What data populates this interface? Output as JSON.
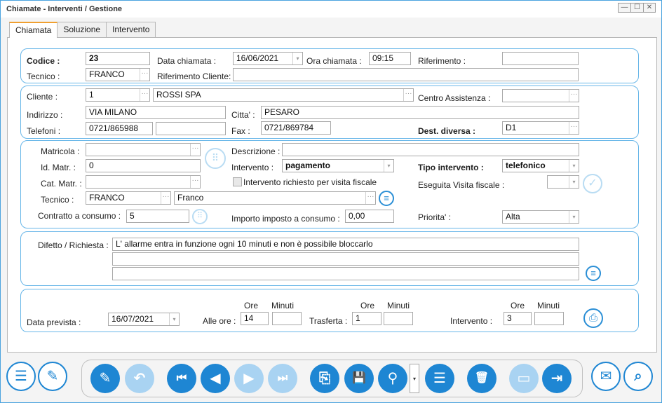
{
  "window": {
    "title": "Chiamate - Interventi / Gestione",
    "btn_min": "—",
    "btn_max": "☐",
    "btn_close": "✕"
  },
  "tabs": [
    {
      "label": "Chiamata"
    },
    {
      "label": "Soluzione"
    },
    {
      "label": "Intervento"
    }
  ],
  "header": {
    "codice_label": "Codice :",
    "codice_value": "23",
    "data_chiamata_label": "Data chiamata :",
    "data_chiamata_value": "16/06/2021",
    "ora_chiamata_label": "Ora chiamata :",
    "ora_chiamata_value": "09:15",
    "riferimento_label": "Riferimento :",
    "riferimento_value": "",
    "tecnico_label": "Tecnico :",
    "tecnico_value": "FRANCO",
    "rif_cliente_label": "Riferimento Cliente:",
    "rif_cliente_value": ""
  },
  "client": {
    "cliente_label": "Cliente :",
    "cliente_code": "1",
    "cliente_name": "ROSSI SPA",
    "centro_label": "Centro Assistenza :",
    "centro_value": "",
    "indirizzo_label": "Indirizzo :",
    "indirizzo_value": "VIA MILANO",
    "citta_label": "Citta' :",
    "citta_value": "PESARO",
    "telefoni_label": "Telefoni :",
    "telefoni_value1": "0721/865988",
    "telefoni_value2": "",
    "fax_label": "Fax :",
    "fax_value": "0721/869784",
    "dest_label": "Dest. diversa :",
    "dest_value": "D1"
  },
  "machine": {
    "matricola_label": "Matricola :",
    "matricola_value": "",
    "descrizione_label": "Descrizione :",
    "descrizione_value": "",
    "idmatr_label": "Id. Matr. :",
    "idmatr_value": "0",
    "intervento_label": "Intervento :",
    "intervento_value": "pagamento",
    "tipo_label": "Tipo intervento :",
    "tipo_value": "telefonico",
    "catmatr_label": "Cat. Matr. :",
    "catmatr_value": "",
    "visita_fiscale_label": "Intervento richiesto per visita fiscale",
    "eseguita_label": "Eseguita Visita fiscale :",
    "eseguita_value": "",
    "tecnico_label": "Tecnico :",
    "tecnico_code": "FRANCO",
    "tecnico_name": "Franco",
    "contratto_label": "Contratto a consumo :",
    "contratto_value": "5",
    "importo_label": "Importo imposto a consumo :",
    "importo_value": "0,00",
    "priorita_label": "Priorita' :",
    "priorita_value": "Alta"
  },
  "difetto": {
    "label": "Difetto / Richiesta :",
    "line1": "L' allarme entra in funzione ogni 10 minuti e non è possibile bloccarlo",
    "line2": "",
    "line3": ""
  },
  "schedule": {
    "data_prevista_label": "Data prevista :",
    "data_prevista_value": "16/07/2021",
    "ore_label": "Ore",
    "minuti_label": "Minuti",
    "alle_ore_label": "Alle ore :",
    "alle_ore_h": "14",
    "alle_ore_m": "",
    "trasferta_label": "Trasferta :",
    "trasferta_h": "1",
    "trasferta_m": "",
    "intervento_label": "Intervento :",
    "intervento_h": "3",
    "intervento_m": ""
  },
  "icons": {
    "brand_color": "#1e86d3",
    "panel_border": "#68b6e8",
    "tab_accent": "#f0a030",
    "ellipsis": "···",
    "dropdown": "▾",
    "grid_icon": "⠿",
    "list_icon": "≡",
    "check_icon": "✓",
    "print_icon": "⎙",
    "database_icon": "☰",
    "edit_icon": "✎",
    "new_doc_icon": "✎",
    "undo_icon": "↶",
    "first_icon": "⏮",
    "prev_icon": "◀",
    "next_icon": "▶",
    "last_icon": "⏭",
    "copy_icon": "⎘",
    "save_icon": "💾",
    "search_icon": "⚲",
    "menu_icon": "☰",
    "delete_icon": "🗑",
    "card_icon": "▭",
    "exit_icon": "⇥",
    "mail_icon": "✉",
    "doc_search_icon": "⌕"
  }
}
